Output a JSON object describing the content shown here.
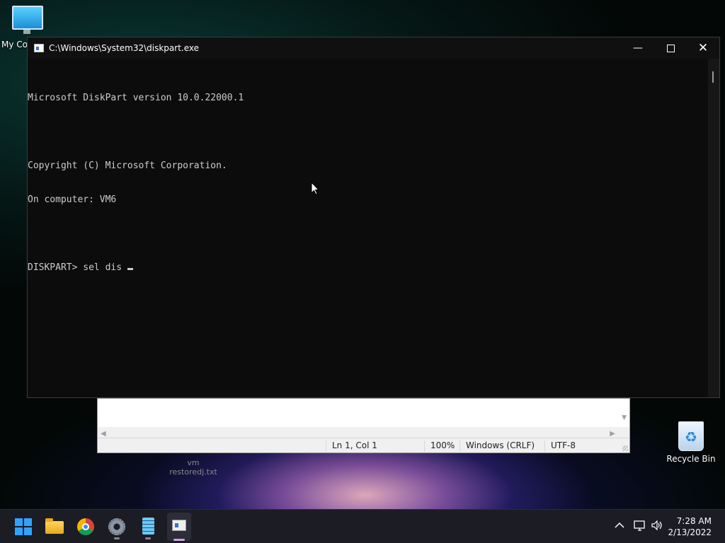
{
  "desktop": {
    "my_computer_label": "My Co",
    "recycle_bin_label": "Recycle Bin",
    "ghost_file_label_line1": "vm",
    "ghost_file_label_line2": "restoredj.txt"
  },
  "notepad": {
    "status": {
      "position": "Ln 1, Col 1",
      "zoom": "100%",
      "line_ending": "Windows (CRLF)",
      "encoding": "UTF-8"
    }
  },
  "console": {
    "title": "C:\\Windows\\System32\\diskpart.exe",
    "lines": [
      "Microsoft DiskPart version 10.0.22000.1",
      "",
      "Copyright (C) Microsoft Corporation.",
      "On computer: VM6",
      "",
      "DISKPART> sel dis "
    ]
  },
  "taskbar": {
    "apps": [
      "start",
      "file-explorer",
      "chrome",
      "settings",
      "notepad",
      "diskpart-console"
    ],
    "clock_time": "7:28 AM",
    "clock_date": "2/13/2022"
  },
  "colors": {
    "console_bg": "#0c0c0c",
    "console_text": "#cccccc",
    "taskbar_bg": "#1c1c24",
    "active_indicator": "#d79be8"
  }
}
